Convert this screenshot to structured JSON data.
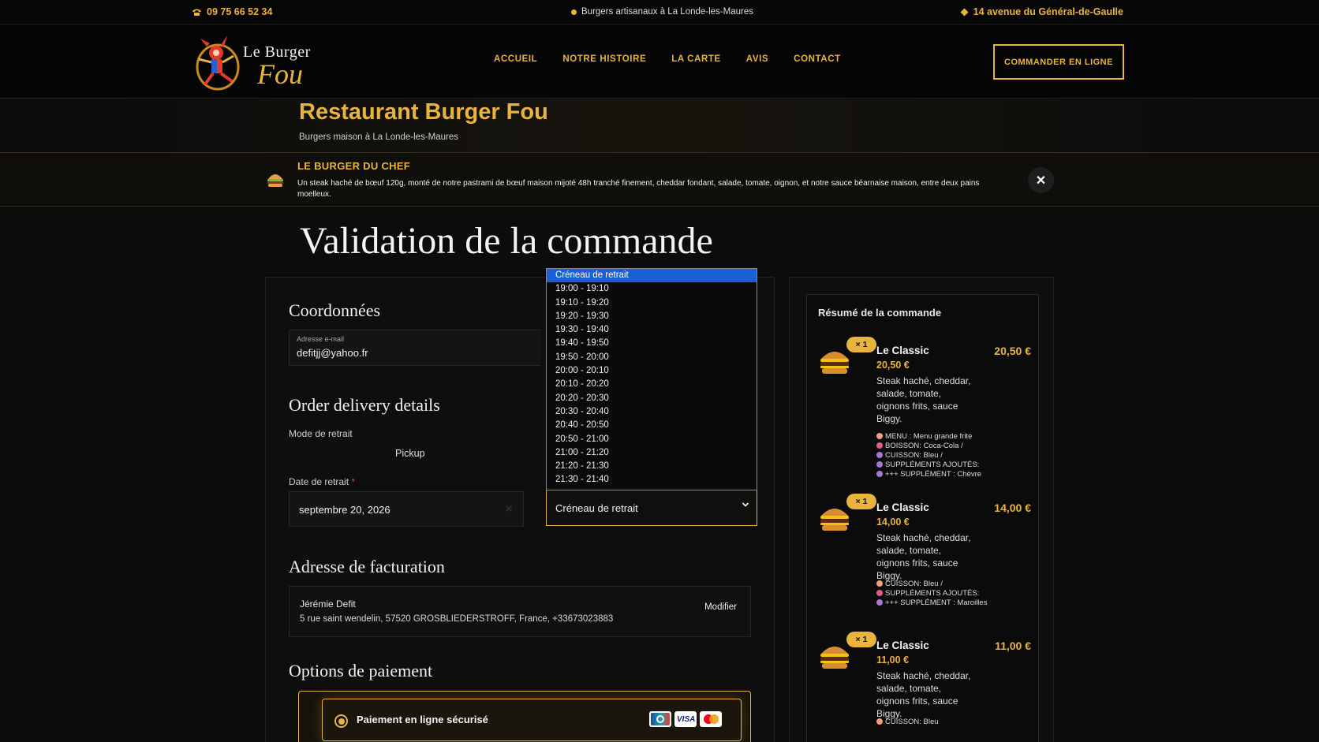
{
  "topbar": {
    "phone": "09 75 66 52 34",
    "tagline": "Burgers artisanaux à La Londe-les-Maures",
    "address": "14 avenue du Général-de-Gaulle"
  },
  "logo": {
    "line1": "Le Burger",
    "line2": "Fou"
  },
  "nav": {
    "items": [
      "ACCUEIL",
      "NOTRE HISTOIRE",
      "LA CARTE",
      "AVIS",
      "CONTACT"
    ],
    "order_button": "COMMANDER EN LIGNE"
  },
  "title_band": {
    "title": "Restaurant Burger Fou",
    "subtitle": "Burgers maison à La Londe-les-Maures"
  },
  "chef_banner": {
    "title": "LE BURGER DU CHEF",
    "description": "Un steak haché de bœuf 120g, monté de notre pastrami de bœuf maison mijoté 48h tranché finement, cheddar fondant, salade, tomate, oignon, et notre sauce béarnaise maison, entre deux pains moelleux.",
    "close": "✕"
  },
  "page_heading": "Validation de la commande",
  "coordonnees": {
    "heading": "Coordonnées",
    "email_label": "Adresse e-mail",
    "email_value": "defitjj@yahoo.fr"
  },
  "delivery": {
    "heading": "Order delivery details",
    "mode_label": "Mode de retrait",
    "mode_value": "Pickup",
    "date_label": "Date de retrait",
    "required": "*",
    "date_value": "septembre 20, 2026",
    "date_clear": "✕",
    "slot_placeholder": "Créneau de retrait",
    "slot_options": [
      "Créneau de retrait",
      "19:00 - 19:10",
      "19:10 - 19:20",
      "19:20 - 19:30",
      "19:30 - 19:40",
      "19:40 - 19:50",
      "19:50 - 20:00",
      "20:00 - 20:10",
      "20:10 - 20:20",
      "20:20 - 20:30",
      "20:30 - 20:40",
      "20:40 - 20:50",
      "20:50 - 21:00",
      "21:00 - 21:20",
      "21:20 - 21:30",
      "21:30 - 21:40"
    ]
  },
  "billing": {
    "heading": "Adresse de facturation",
    "name": "Jérémie Defit",
    "address": "5 rue saint wendelin, 57520 GROSBLIEDERSTROFF, France, +33673023883",
    "modify": "Modifier"
  },
  "payment": {
    "heading": "Options de paiement",
    "option_label": "Paiement en ligne sécurisé",
    "cards": [
      "CB",
      "VISA",
      "Mastercard"
    ]
  },
  "summary": {
    "heading": "Résumé de la commande",
    "items": [
      {
        "qty": "× 1",
        "name": "Le Classic",
        "total": "20,50 €",
        "unit": "20,50 €",
        "desc": "Steak haché, cheddar, salade, tomate, oignons frits, sauce Biggy.",
        "options": [
          "MENU : Menu grande frite",
          "BOISSON: Coca-Cola /",
          "CUISSON: Bleu /",
          "SUPPLÉMENTS AJOUTÉS:",
          "+++ SUPPLÉMENT : Chèvre"
        ]
      },
      {
        "qty": "× 1",
        "name": "Le Classic",
        "total": "14,00 €",
        "unit": "14,00 €",
        "desc": "Steak haché, cheddar, salade, tomate, oignons frits, sauce Biggy.",
        "options": [
          "CUISSON: Bleu /",
          "SUPPLÉMENTS AJOUTÉS:",
          "+++ SUPPLÉMENT : Maroilles"
        ]
      },
      {
        "qty": "× 1",
        "name": "Le Classic",
        "total": "11,00 €",
        "unit": "11,00 €",
        "desc": "Steak haché, cheddar, salade, tomate, oignons frits, sauce Biggy.",
        "options": [
          "CUISSON: Bleu"
        ]
      }
    ]
  },
  "colors": {
    "accent": "#e9b43d",
    "background": "#0c0c0c",
    "selected_option": "#1a5fd6"
  }
}
